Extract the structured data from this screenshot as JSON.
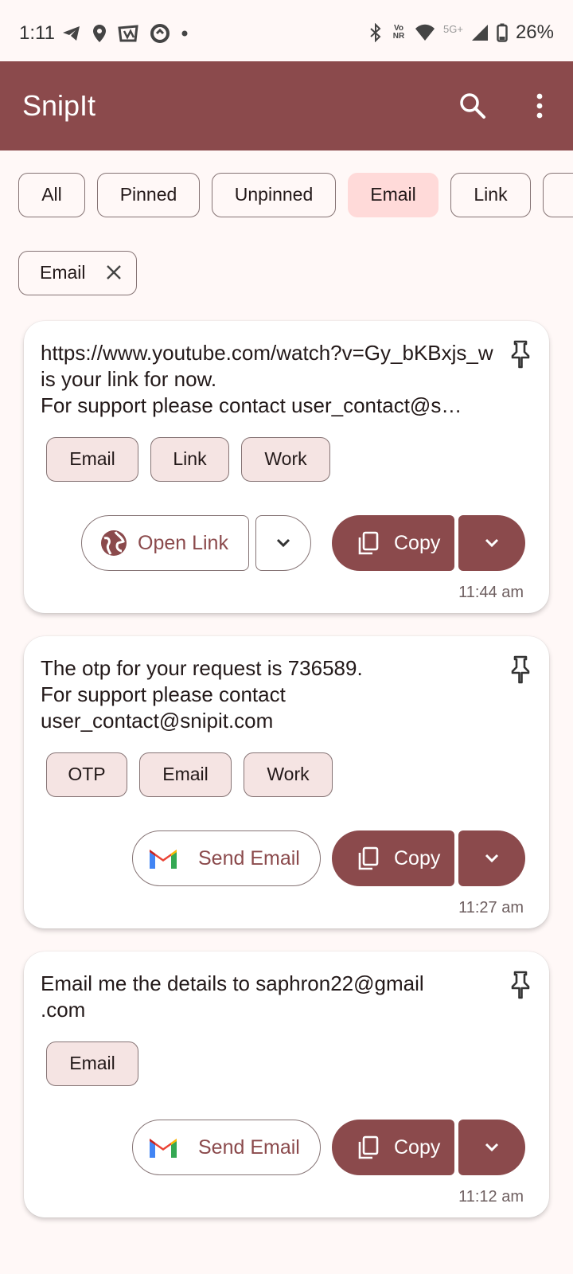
{
  "status": {
    "time": "1:11",
    "battery": "26%",
    "volte": "Vo NR",
    "network": "5G+"
  },
  "app": {
    "title": "SnipIt"
  },
  "filters": [
    "All",
    "Pinned",
    "Unpinned",
    "Email",
    "Link"
  ],
  "active_filter": {
    "label": "Email"
  },
  "colors": {
    "primary": "#8b4a4c",
    "selected_chip": "#ffdad9",
    "background": "#fff8f7"
  },
  "cards": [
    {
      "text": "https://www.youtube.com/watch?v=Gy_bKBxjs_w is your link for now.\nFor support please contact user_contact@s…",
      "tags": [
        "Email",
        "Link",
        "Work"
      ],
      "action": "Open Link",
      "copy": "Copy",
      "time": "11:44 am"
    },
    {
      "text": "The otp for your request is 736589.\nFor support please contact\nuser_contact@snipit.com",
      "tags": [
        "OTP",
        "Email",
        "Work"
      ],
      "action": "Send Email",
      "copy": "Copy",
      "time": "11:27 am"
    },
    {
      "text": "Email me the details to saphron22@gmail\n.com",
      "tags": [
        "Email"
      ],
      "action": "Send Email",
      "copy": "Copy",
      "time": "11:12 am"
    }
  ]
}
